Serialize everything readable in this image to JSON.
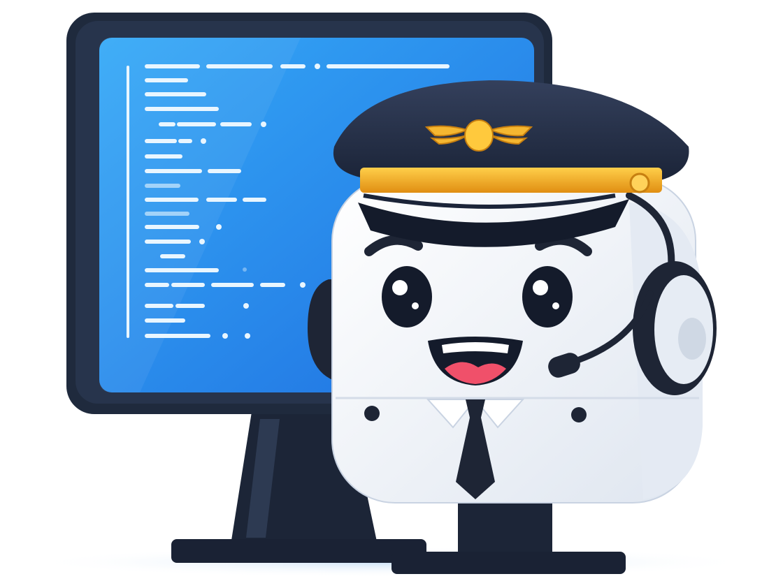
{
  "scene": {
    "subject": "pilot-robot-mascot",
    "monitor_screen_color": "#2a8ff0",
    "monitor_frame_color": "#1f2a3d",
    "robot_body_color": "#f2f5fa",
    "cap_color": "#24304a",
    "cap_band_color": "#f2a31b",
    "mouth_tongue_color": "#f0506a",
    "headset_color": "#1e2535"
  }
}
